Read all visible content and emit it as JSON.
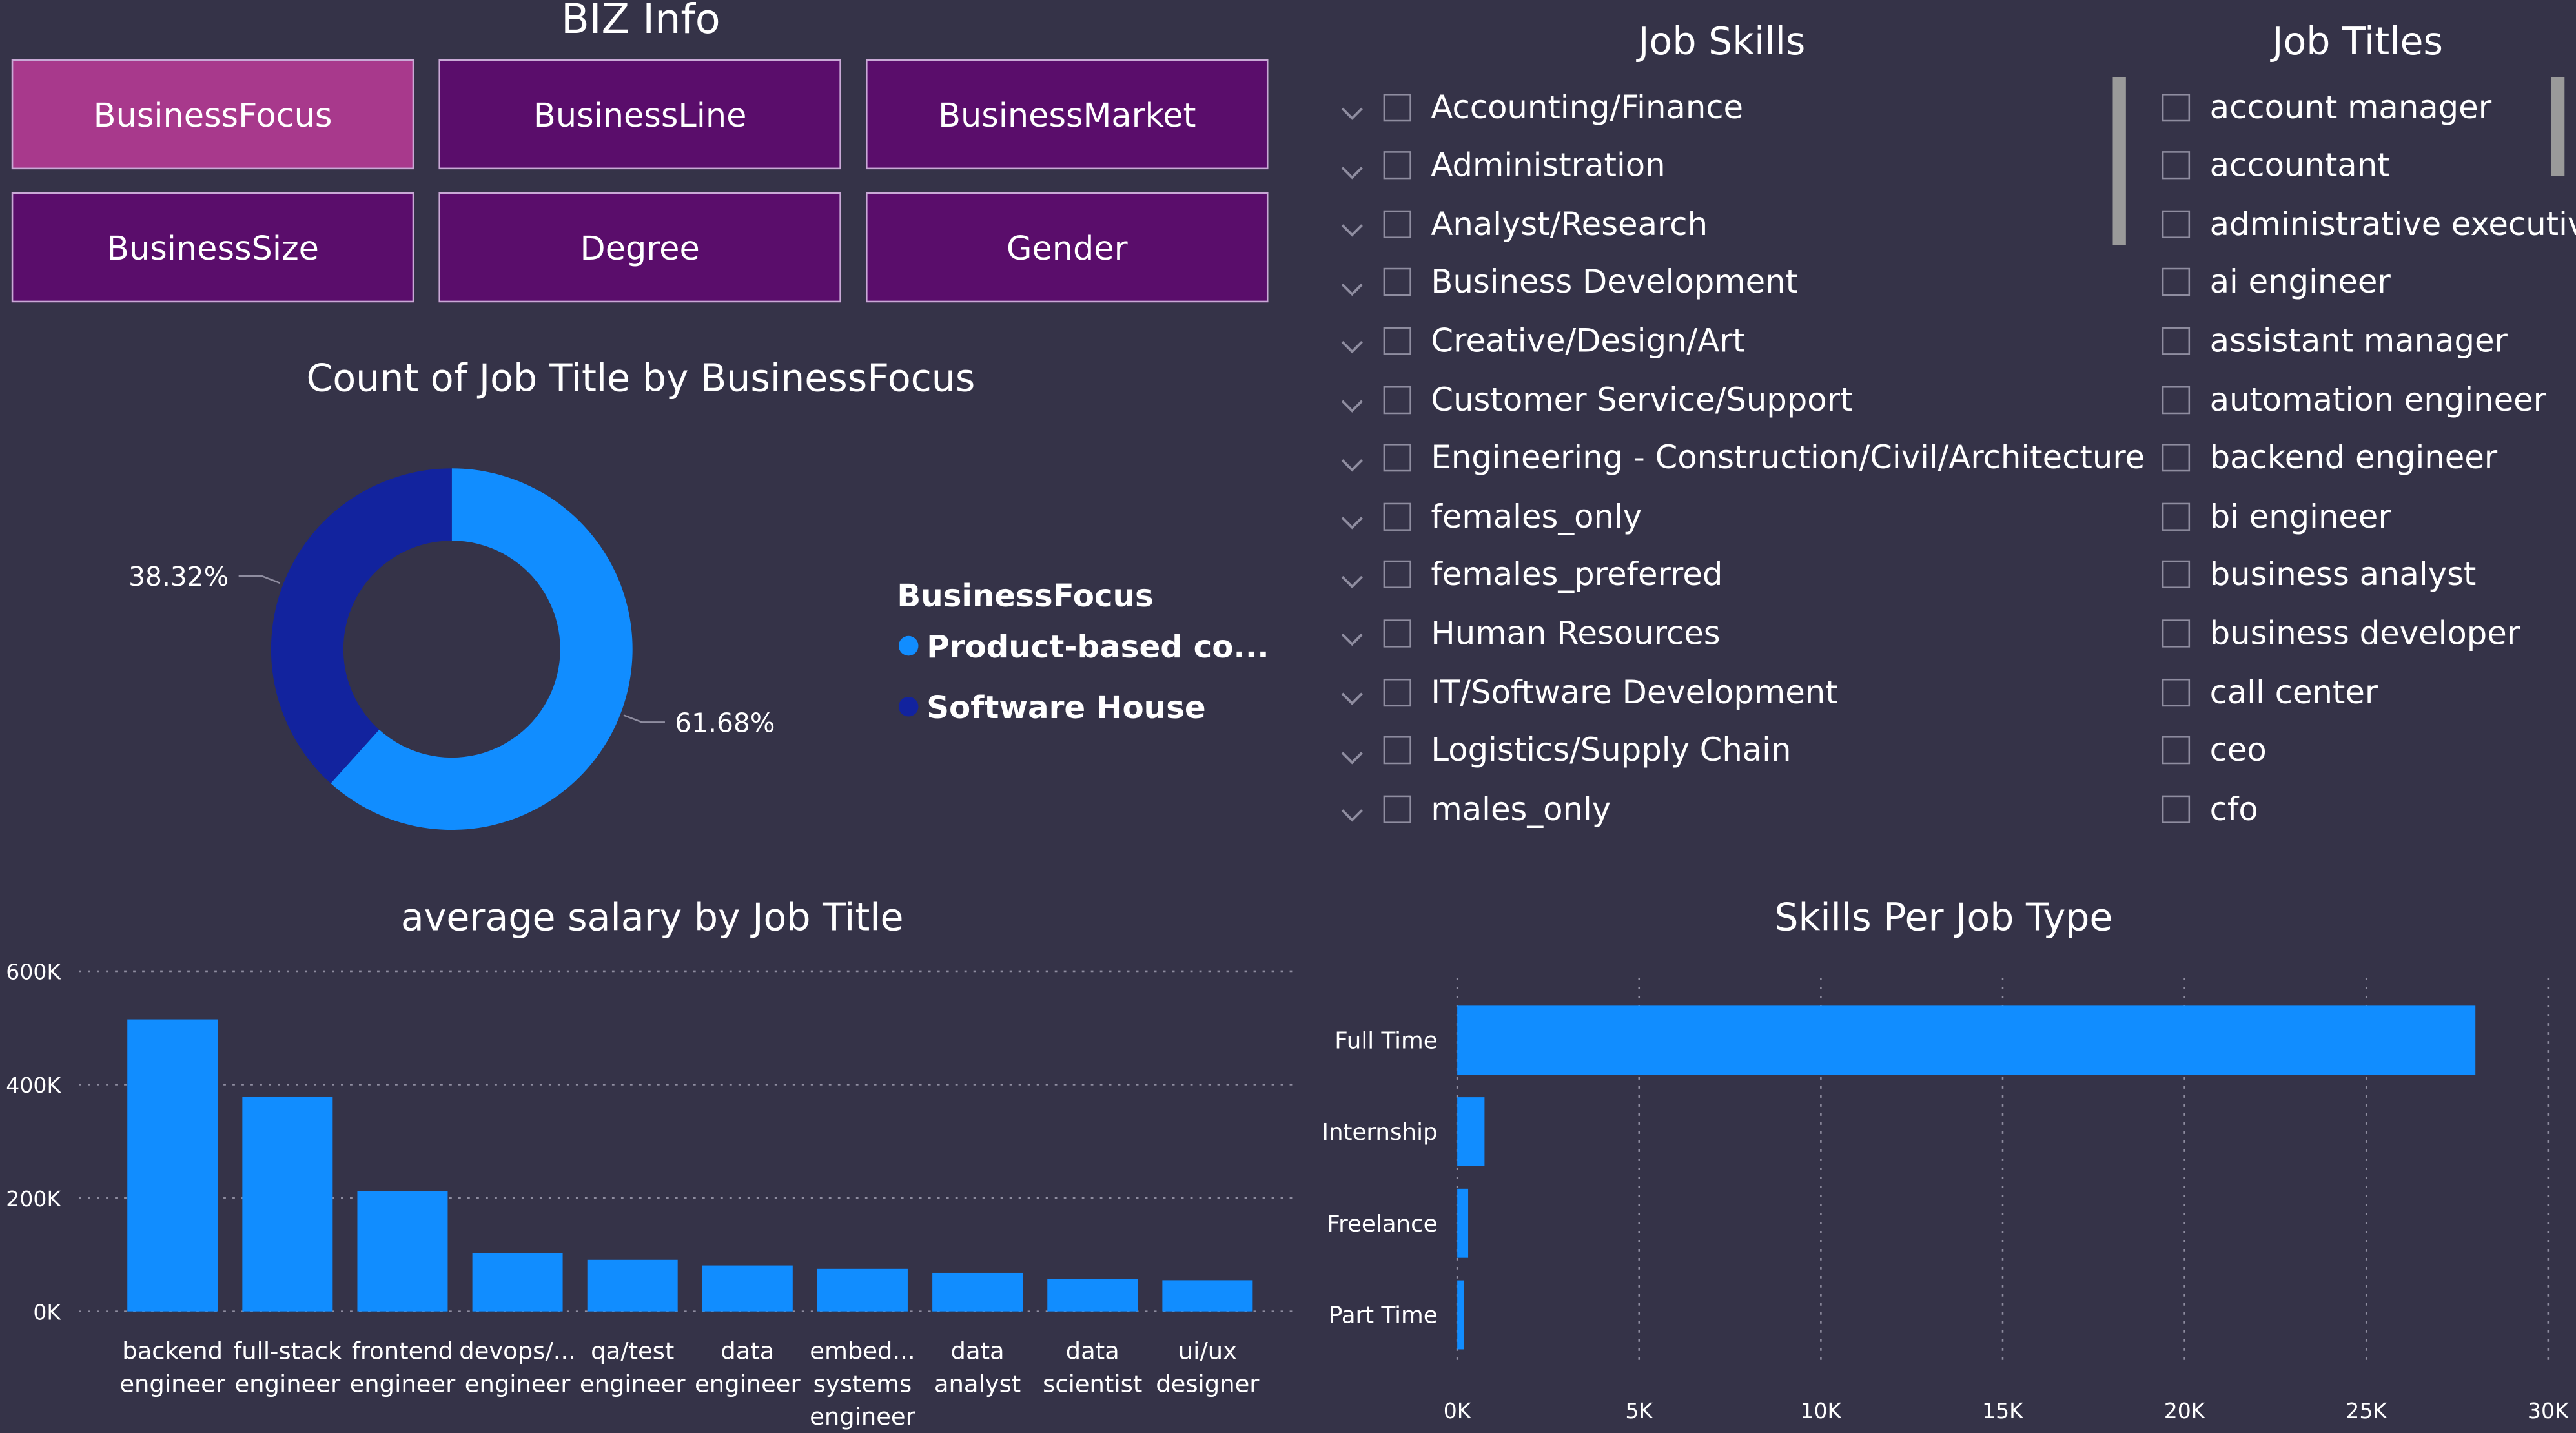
{
  "biz_info": {
    "title": "BIZ Info",
    "buttons": [
      "BusinessFocus",
      "BusinessLine",
      "BusinessMarket",
      "BusinessSize",
      "Degree",
      "Gender"
    ],
    "active": "BusinessFocus"
  },
  "job_skills": {
    "title": "Job Skills",
    "items": [
      "Accounting/Finance",
      "Administration",
      "Analyst/Research",
      "Business Development",
      "Creative/Design/Art",
      "Customer Service/Support",
      "Engineering - Construction/Civil/Architecture",
      "females_only",
      "females_preferred",
      "Human Resources",
      "IT/Software Development",
      "Logistics/Supply Chain",
      "males_only"
    ]
  },
  "job_titles": {
    "title": "Job Titles",
    "items": [
      "account manager",
      "accountant",
      "administrative executive",
      "ai engineer",
      "assistant manager",
      "automation engineer",
      "backend engineer",
      "bi engineer",
      "business analyst",
      "business developer",
      "call center",
      "ceo",
      "cfo"
    ]
  },
  "colors": {
    "background": "#353348",
    "bar": "#118dff",
    "dark_series": "#12239e",
    "button": "#5a0d6b",
    "button_active": "#a8398c"
  },
  "chart_data": [
    {
      "type": "pie",
      "variant": "donut",
      "title": "Count of Job Title by BusinessFocus",
      "legend_title": "BusinessFocus",
      "legend_position": "right",
      "categories": [
        "Product-based co...",
        "Software House"
      ],
      "values": [
        61.68,
        38.32
      ],
      "labels": [
        "61.68%",
        "38.32%"
      ],
      "colors": [
        "#118dff",
        "#12239e"
      ]
    },
    {
      "type": "bar",
      "title": "average salary by Job Title",
      "categories": [
        [
          "backend",
          "engineer"
        ],
        [
          "full-stack",
          "engineer"
        ],
        [
          "frontend",
          "engineer"
        ],
        [
          "devops/...",
          "engineer"
        ],
        [
          "qa/test",
          "engineer"
        ],
        [
          "data",
          "engineer"
        ],
        [
          "embed...",
          "systems",
          "engineer"
        ],
        [
          "data",
          "analyst"
        ],
        [
          "data",
          "scientist"
        ],
        [
          "ui/ux",
          "designer"
        ]
      ],
      "values": [
        515000,
        378000,
        212000,
        103000,
        91000,
        81000,
        75000,
        68000,
        57000,
        55000
      ],
      "ylim": [
        0,
        600000
      ],
      "yticks": [
        0,
        200000,
        400000,
        600000
      ],
      "ytick_labels": [
        "0K",
        "200K",
        "400K",
        "600K"
      ],
      "grid": true
    },
    {
      "type": "bar",
      "orientation": "horizontal",
      "title": "Skills Per Job Type",
      "categories": [
        "Full Time",
        "Internship",
        "Freelance",
        "Part Time"
      ],
      "values": [
        28000,
        750,
        300,
        180
      ],
      "xlim": [
        0,
        30000
      ],
      "xticks": [
        0,
        5000,
        10000,
        15000,
        20000,
        25000,
        30000
      ],
      "xtick_labels": [
        "0K",
        "5K",
        "10K",
        "15K",
        "20K",
        "25K",
        "30K"
      ],
      "grid": true
    }
  ]
}
